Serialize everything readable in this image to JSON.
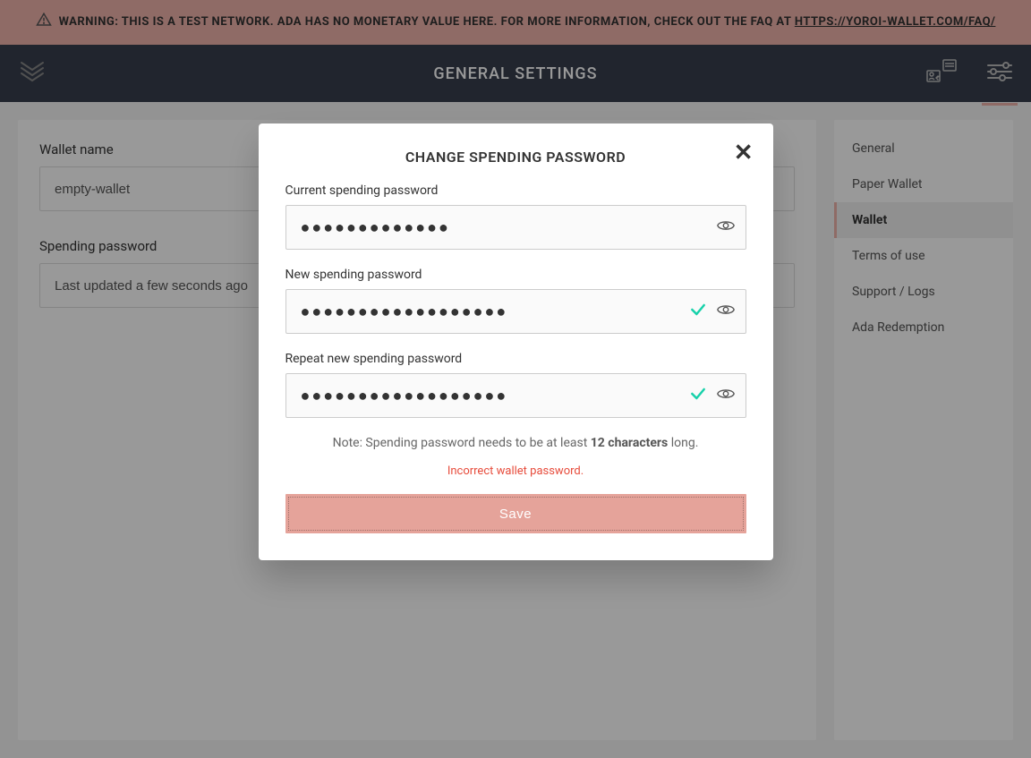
{
  "warning": {
    "text_prefix": "WARNING: THIS IS A TEST NETWORK. ADA HAS NO MONETARY VALUE HERE. FOR MORE INFORMATION, CHECK OUT THE FAQ AT ",
    "link_text": "HTTPS://YOROI-WALLET.COM/FAQ/"
  },
  "topbar": {
    "title": "GENERAL SETTINGS"
  },
  "main": {
    "wallet_name": {
      "label": "Wallet name",
      "value": "empty-wallet"
    },
    "spending_password": {
      "label": "Spending password",
      "value": "Last updated a few seconds ago"
    }
  },
  "sidebar": {
    "items": [
      {
        "label": "General"
      },
      {
        "label": "Paper Wallet"
      },
      {
        "label": "Wallet"
      },
      {
        "label": "Terms of use"
      },
      {
        "label": "Support / Logs"
      },
      {
        "label": "Ada Redemption"
      }
    ],
    "active_index": 2
  },
  "modal": {
    "title": "CHANGE SPENDING PASSWORD",
    "fields": {
      "current": {
        "label": "Current spending password",
        "masked": "●●●●●●●●●●●●●"
      },
      "new": {
        "label": "New spending password",
        "masked": "●●●●●●●●●●●●●●●●●●"
      },
      "repeat": {
        "label": "Repeat new spending password",
        "masked": "●●●●●●●●●●●●●●●●●●"
      }
    },
    "note_prefix": "Note: Spending password needs to be at least ",
    "note_strong": "12 characters",
    "note_suffix": " long.",
    "error": "Incorrect wallet password.",
    "save_label": "Save"
  },
  "colors": {
    "accent": "#efb3ab",
    "error": "#e74c3c",
    "valid_check": "#17d1aa"
  }
}
